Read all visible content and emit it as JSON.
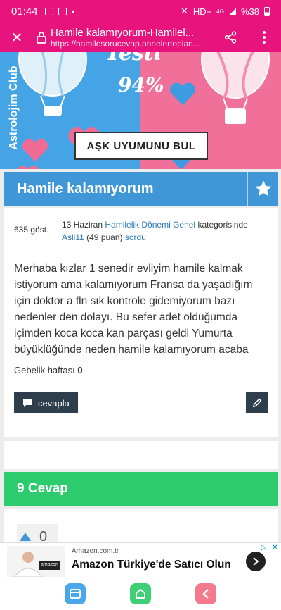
{
  "status": {
    "time": "01:44",
    "network": "HD+",
    "net_sub": "4G",
    "battery": "%38"
  },
  "browser": {
    "title": "Hamile kalamıyorum-Hamilel...",
    "url": "https://hamilesorucevap.annelertoplan..."
  },
  "banner": {
    "side_text": "Astrolojim Club",
    "big_text": "Testi",
    "percent": "94%",
    "cta": "AŞK UYUMUNU BUL"
  },
  "question": {
    "title": "Hamile kalamıyorum",
    "views": "635 göst.",
    "date": "13 Haziran",
    "category": "Hamilelik Dönemi Genel",
    "category_suffix": "kategorisinde",
    "author": "Asli11",
    "points": "(49 puan)",
    "action": "sordu",
    "body": "Merhaba kızlar 1 senedir evliyim hamile kalmak istiyorum ama kalamıyorum Fransa da yaşadığım için doktor a fln sık kontrole gidemiyorum bazı nedenler den dolayı. Bu sefer adet olduğumda içimden koca koca kan parçası geldi Yumurta büyüklüğünde neden hamile kalamıyorum acaba",
    "week_label": "Gebelik haftası",
    "week_value": "0",
    "reply_label": "cevapla"
  },
  "answers": {
    "count_label": "9 Cevap",
    "first_votes": "0"
  },
  "ad": {
    "source": "Amazon.com.tr",
    "headline": "Amazon Türkiye'de Satıcı Olun",
    "thumb_text": "amazon"
  },
  "colors": {
    "accent": "#e8147e",
    "header_blue": "#3f97d8",
    "answers_green": "#2ccc6e",
    "button_dark": "#2f3e4c"
  }
}
